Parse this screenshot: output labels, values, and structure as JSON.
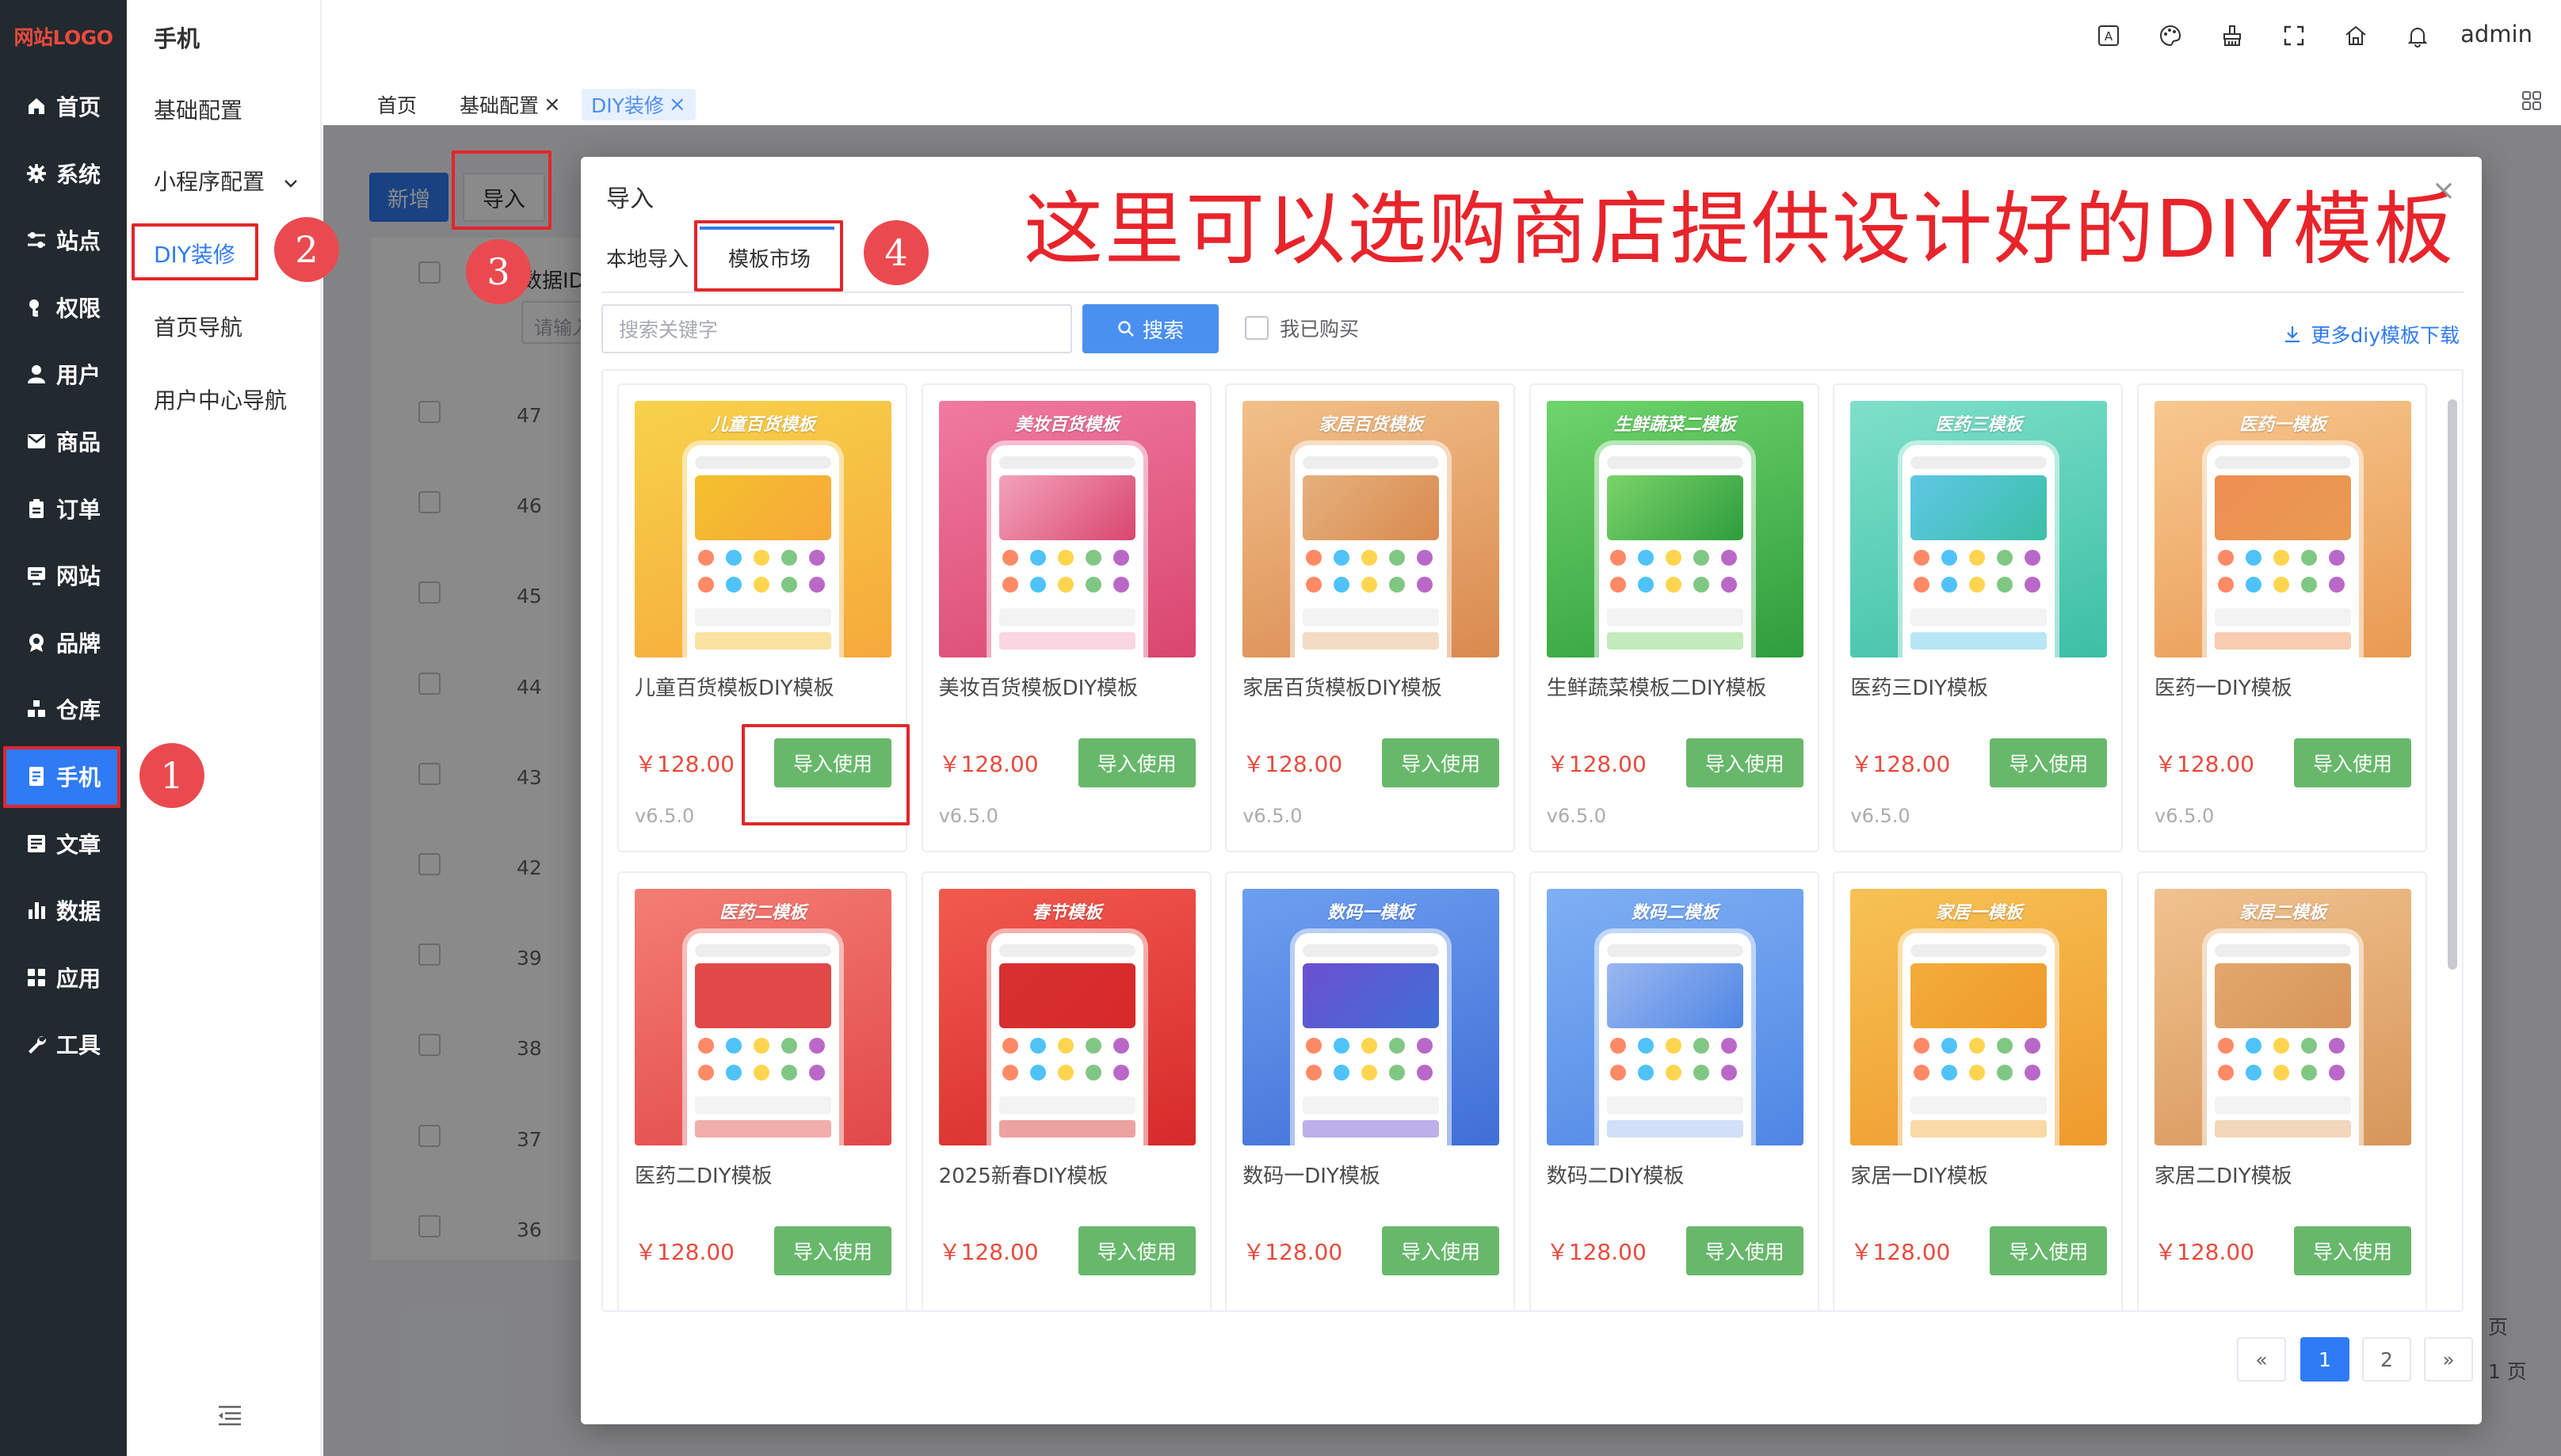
{
  "sidebar": {
    "logo": "网站LOGO",
    "items": [
      {
        "label": "首页",
        "icon": "home-icon"
      },
      {
        "label": "系统",
        "icon": "gear-icon"
      },
      {
        "label": "站点",
        "icon": "sliders-icon"
      },
      {
        "label": "权限",
        "icon": "key-icon"
      },
      {
        "label": "用户",
        "icon": "user-icon"
      },
      {
        "label": "商品",
        "icon": "mail-icon"
      },
      {
        "label": "订单",
        "icon": "clipboard-icon"
      },
      {
        "label": "网站",
        "icon": "monitor-icon"
      },
      {
        "label": "品牌",
        "icon": "brand-icon"
      },
      {
        "label": "仓库",
        "icon": "warehouse-icon"
      },
      {
        "label": "手机",
        "icon": "phone-icon",
        "active": true
      },
      {
        "label": "文章",
        "icon": "article-icon"
      },
      {
        "label": "数据",
        "icon": "chart-icon"
      },
      {
        "label": "应用",
        "icon": "apps-icon"
      },
      {
        "label": "工具",
        "icon": "wrench-icon"
      }
    ]
  },
  "submenu": {
    "title": "手机",
    "items": [
      {
        "label": "基础配置"
      },
      {
        "label": "小程序配置"
      },
      {
        "label": "DIY装修",
        "active": true
      },
      {
        "label": "首页导航"
      },
      {
        "label": "用户中心导航"
      }
    ]
  },
  "header": {
    "user": "admin",
    "icons": [
      "translate-icon",
      "palette-icon",
      "clear-cache-icon",
      "fullscreen-icon",
      "home-icon",
      "bell-icon"
    ]
  },
  "tabs": [
    {
      "label": "首页"
    },
    {
      "label": "基础配置",
      "close": "×"
    },
    {
      "label": "DIY装修",
      "close": "×",
      "active": true
    }
  ],
  "background": {
    "add_label": "新增",
    "import_label": "导入",
    "id_header": "数据ID",
    "id_placeholder": "请输入",
    "row_ids": [
      "47",
      "46",
      "45",
      "44",
      "43",
      "42",
      "39",
      "38",
      "37",
      "36"
    ],
    "right_text_1": "页",
    "right_text_2": "1 页"
  },
  "modal": {
    "title": "导入",
    "close_icon": "×",
    "tab_local": "本地导入",
    "tab_market": "模板市场",
    "search_placeholder": "搜索关键字",
    "search_label": "搜索",
    "bought_label": "我已购买",
    "more_link": "更多diy模板下载",
    "annotation": "这里可以选购商店提供设计好的DIY模板",
    "templates": [
      {
        "thumb_title": "儿童百货模板",
        "name": "儿童百货模板DIY模板",
        "price": "￥128.00",
        "button": "导入使用",
        "version": "v6.5.0",
        "c1": "#f7d24a",
        "c2": "#f6a93b",
        "accent": "#f4c02d"
      },
      {
        "thumb_title": "美妆百货模板",
        "name": "美妆百货模板DIY模板",
        "price": "￥128.00",
        "button": "导入使用",
        "version": "v6.5.0",
        "c1": "#f07aa0",
        "c2": "#d9466f",
        "accent": "#f2a3bb"
      },
      {
        "thumb_title": "家居百货模板",
        "name": "家居百货模板DIY模板",
        "price": "￥128.00",
        "button": "导入使用",
        "version": "v6.5.0",
        "c1": "#f2c08a",
        "c2": "#d98a4e",
        "accent": "#e5b17e"
      },
      {
        "thumb_title": "生鲜蔬菜二模板",
        "name": "生鲜蔬菜模板二DIY模板",
        "price": "￥128.00",
        "button": "导入使用",
        "version": "v6.5.0",
        "c1": "#6fd46b",
        "c2": "#2e9d3d",
        "accent": "#7bd36a"
      },
      {
        "thumb_title": "医药三模板",
        "name": "医药三DIY模板",
        "price": "￥128.00",
        "button": "导入使用",
        "version": "v6.5.0",
        "c1": "#7fe0c9",
        "c2": "#3cbfa6",
        "accent": "#5fc7e6"
      },
      {
        "thumb_title": "医药一模板",
        "name": "医药一DIY模板",
        "price": "￥128.00",
        "button": "导入使用",
        "version": "v6.5.0",
        "c1": "#f7c890",
        "c2": "#e99a52",
        "accent": "#ee8f52"
      },
      {
        "thumb_title": "医药二模板",
        "name": "医药二DIY模板",
        "price": "￥128.00",
        "button": "导入使用",
        "version": "",
        "c1": "#f47e74",
        "c2": "#e14848",
        "accent": "#e24a4a"
      },
      {
        "thumb_title": "春节模板",
        "name": "2025新春DIY模板",
        "price": "￥128.00",
        "button": "导入使用",
        "version": "",
        "c1": "#f25a4f",
        "c2": "#d62a2a",
        "accent": "#d83030"
      },
      {
        "thumb_title": "数码一模板",
        "name": "数码一DIY模板",
        "price": "￥128.00",
        "button": "导入使用",
        "version": "",
        "c1": "#6d9ff0",
        "c2": "#3f6fd6",
        "accent": "#6d4fd0"
      },
      {
        "thumb_title": "数码二模板",
        "name": "数码二DIY模板",
        "price": "￥128.00",
        "button": "导入使用",
        "version": "",
        "c1": "#7fb0f4",
        "c2": "#4f86e4",
        "accent": "#9bb7f0"
      },
      {
        "thumb_title": "家居一模板",
        "name": "家居一DIY模板",
        "price": "￥128.00",
        "button": "导入使用",
        "version": "",
        "c1": "#f7c255",
        "c2": "#ef9a2c",
        "accent": "#f2ac3a"
      },
      {
        "thumb_title": "家居二模板",
        "name": "家居二DIY模板",
        "price": "￥128.00",
        "button": "导入使用",
        "version": "",
        "c1": "#f0c28f",
        "c2": "#d7965a",
        "accent": "#e3a76b"
      }
    ],
    "pagination": {
      "prev": "«",
      "pages": [
        "1",
        "2"
      ],
      "current": "1",
      "next": "»"
    }
  },
  "annotations": {
    "steps": [
      "1",
      "2",
      "3",
      "4"
    ]
  },
  "colors": {
    "primary": "#2f7bf3",
    "success": "#67b86b",
    "price": "#e84a3c",
    "annotation": "#e2262a",
    "sidebar_bg": "#22292f"
  }
}
